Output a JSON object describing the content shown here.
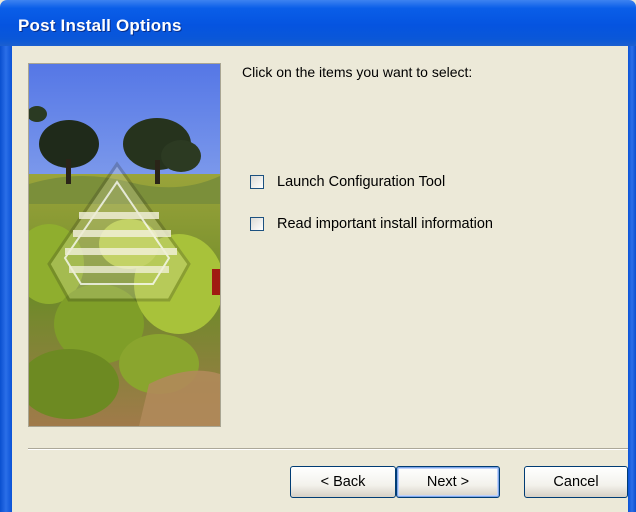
{
  "window": {
    "title": "Post Install Options"
  },
  "main": {
    "instructions": "Click on the items you want to select:",
    "options": [
      {
        "label": "Launch Configuration Tool",
        "checked": false
      },
      {
        "label": "Read important install information",
        "checked": false
      }
    ]
  },
  "buttons": {
    "back": "< Back",
    "next": "Next >",
    "cancel": "Cancel"
  },
  "colors": {
    "title_bar": "#0554e0",
    "window_background": "#ece9d8",
    "button_border": "#003c74"
  },
  "icons": {
    "side_image": "vineyard-logo-image"
  }
}
